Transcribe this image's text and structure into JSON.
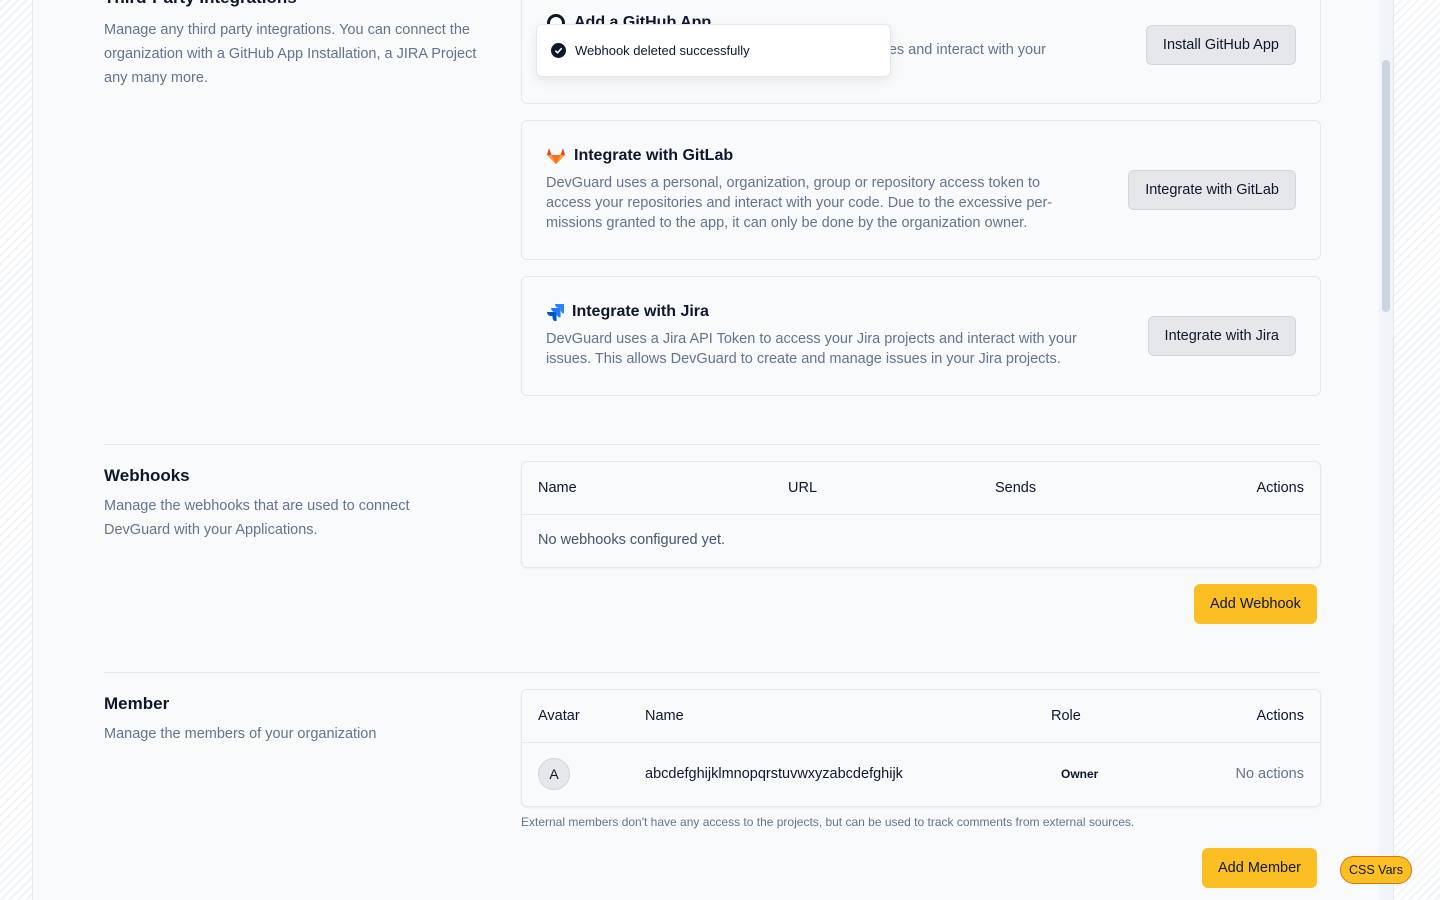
{
  "third_party": {
    "title": "Third-Party Integrations",
    "description": "Manage any third party integrations. You can connect the organization with a GitHub App Installation, a JIRA Project any many more.",
    "github": {
      "title": "Add a GitHub App",
      "description_visible": "ories and interact with your",
      "button": "Install GitHub App"
    },
    "gitlab": {
      "title": "Integrate with GitLab",
      "description": "DevGuard uses a personal, organization, group or repository access token to access your repositories and interact with your code. Due to the excessive per-missions granted to the app, it can only be done by the organization owner.",
      "button": "Integrate with GitLab"
    },
    "jira": {
      "title": "Integrate with Jira",
      "description": "DevGuard uses a Jira API Token to access your Jira projects and interact with your issues. This allows DevGuard to create and manage issues in your Jira projects.",
      "button": "Integrate with Jira"
    }
  },
  "toast": {
    "message": "Webhook deleted successfully"
  },
  "webhooks": {
    "title": "Webhooks",
    "description": "Manage the webhooks that are used to connect DevGuard with your Applications.",
    "columns": [
      "Name",
      "URL",
      "Sends",
      "Actions"
    ],
    "empty": "No webhooks configured yet.",
    "add_button": "Add Webhook"
  },
  "members": {
    "title": "Member",
    "description": "Manage the members of your organization",
    "columns": [
      "Avatar",
      "Name",
      "Role",
      "Actions"
    ],
    "rows": [
      {
        "avatar": "A",
        "name": "abcdefghijklmnopqrstuvwxyzabcdefghijk",
        "role": "Owner",
        "actions": "No actions"
      }
    ],
    "note": "External members don't have any access to the projects, but can be used to track comments from external sources.",
    "add_button": "Add Member"
  },
  "css_vars": {
    "label": "CSS Vars"
  },
  "colors": {
    "primary": "#fbbf24",
    "secondary": "#e5e7eb",
    "text_muted": "#64748b",
    "gitlab": "#e24329",
    "jira": "#2684ff"
  }
}
